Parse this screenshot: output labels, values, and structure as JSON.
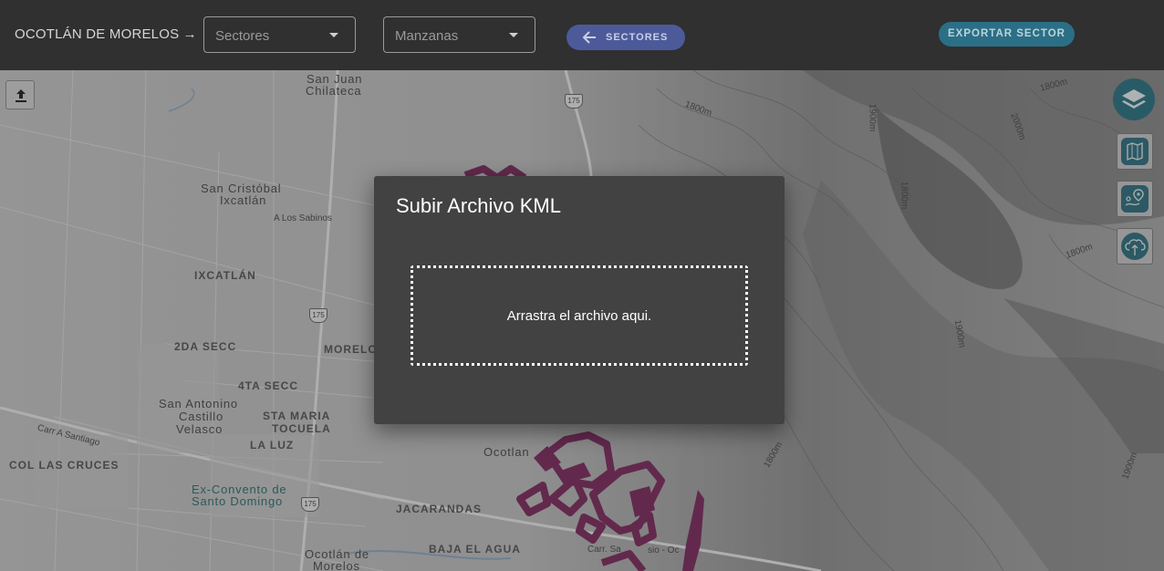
{
  "header": {
    "place": "OCOTLÁN DE MORELOS →",
    "sectores_select": "Sectores",
    "manzanas_select": "Manzanas",
    "back_button": "SECTORES",
    "export_button": "EXPORTAR SECTOR"
  },
  "map": {
    "labels": {
      "san_juan": "San Juan",
      "chilateca": "Chilateca",
      "san_cristobal": "San Cristóbal",
      "ixcatlan_small": "Ixcatlán",
      "a_los_sabinos": "A Los Sabinos",
      "ixcatlan": "IXCATLÁN",
      "dos_da_secc": "2DA SECC",
      "morelos": "MORELO",
      "cuarta_secc": "4TA SECC",
      "san_antonino": "San Antonino",
      "castillo": "Castillo",
      "velasco": "Velasco",
      "sta_maria": "STA MARIA",
      "toquela": "TOCUELA",
      "la_luz": "LA LUZ",
      "carr_santiago": "Carr A Santiago",
      "col_las_cruces": "COL LAS CRUCES",
      "ex_convento": "Ex-Convento de",
      "santo_domingo": "Santo Domingo",
      "jacarandas": "JACARANDAS",
      "ocotlan": "Ocotlan",
      "baja_el_agua": "BAJA EL AGUA",
      "ocotlan_de": "Ocotlán de",
      "morelos_bottom": "Morelos",
      "carr_sa": "Carr. Sa",
      "sio_oc": "sio - Oc",
      "hwy_175": "175"
    },
    "contours": [
      "1800m",
      "2000m",
      "1900m",
      "1800m",
      "1900m",
      "1800m",
      "1900m",
      "1800m"
    ],
    "polygon_color": "#7b2a5e",
    "accent_teal": "#2a7182"
  },
  "controls": {
    "upload_icon": "upload-icon",
    "layers_icon": "layers-icon",
    "side_icons": [
      "map-icon",
      "location-route-icon",
      "cloud-upload-icon"
    ]
  },
  "dialog": {
    "title": "Subir Archivo KML",
    "dropzone_text": "Arrastra el archivo aqui."
  }
}
